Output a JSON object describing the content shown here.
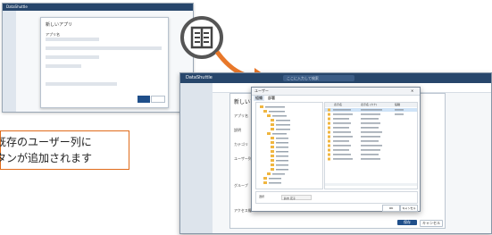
{
  "small_screen": {
    "app_title": "DataShuttle",
    "modal_title": "新しいアプリ",
    "field_label": "アプリ名"
  },
  "icon": {
    "name": "list-columns-icon"
  },
  "callout": {
    "line1": "既存のユーザー列に",
    "line2": "タンが追加されます",
    "border_color": "#e06b1a"
  },
  "big_screen": {
    "app_title": "DataShuttle",
    "search_placeholder": "ここに入力して検索",
    "modal_title": "新しいア",
    "modal_labels": [
      "アプリ名",
      "説明",
      "カテゴリ",
      "ユーザー列",
      "グループ",
      "アクセス権"
    ],
    "modal_buttons": [
      "保存",
      "キャンセル"
    ],
    "accent": "#1f4f8a"
  },
  "dialog": {
    "title": "ユーザー",
    "tabs": [
      "組織",
      "部署"
    ],
    "grid_headers": [
      "表示名",
      "表示名 (カナ)",
      "役職"
    ],
    "selected_label": "選択",
    "chip": "鈴木 花子",
    "buttons": [
      "OK",
      "キャンセル"
    ]
  }
}
